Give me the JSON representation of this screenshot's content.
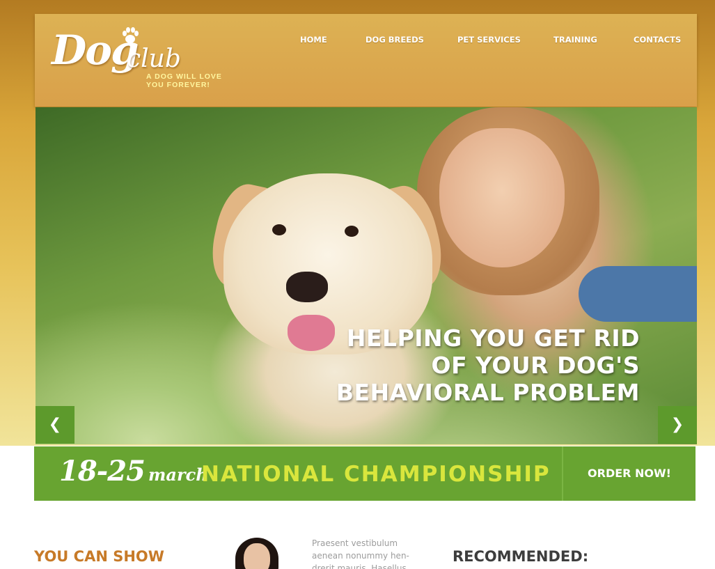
{
  "header": {
    "logo_word": "Dog",
    "logo_sub": "club",
    "tagline_line1": "A DOG WILL LOVE",
    "tagline_line2": "YOU FOREVER!",
    "nav": [
      {
        "label": "HOME"
      },
      {
        "label": "DOG BREEDS"
      },
      {
        "label": "PET SERVICES"
      },
      {
        "label": "TRAINING"
      },
      {
        "label": "CONTACTS"
      }
    ]
  },
  "hero": {
    "caption_lines": [
      "HELPING YOU GET RID",
      "OF YOUR DOG'S",
      "BEHAVIORAL PROBLEM"
    ],
    "prev_arrow": "❮",
    "next_arrow": "❯"
  },
  "banner": {
    "date_range": "18-25",
    "date_month": "march",
    "title": "NATIONAL CHAMPIONSHIP",
    "order_label": "ORDER NOW!"
  },
  "content": {
    "show_heading": "YOU CAN SHOW",
    "lorem_line1": "Praesent vestibulum",
    "lorem_line2": "aenean nonummy hen-",
    "lorem_line3": "drerit mauris. Hasellus",
    "recommended_heading": "RECOMMENDED:"
  },
  "colors": {
    "accent_green": "#68a431",
    "banner_title": "#d9e63d",
    "heading_orange": "#c77a28",
    "header_gold": "#d9a04a"
  }
}
